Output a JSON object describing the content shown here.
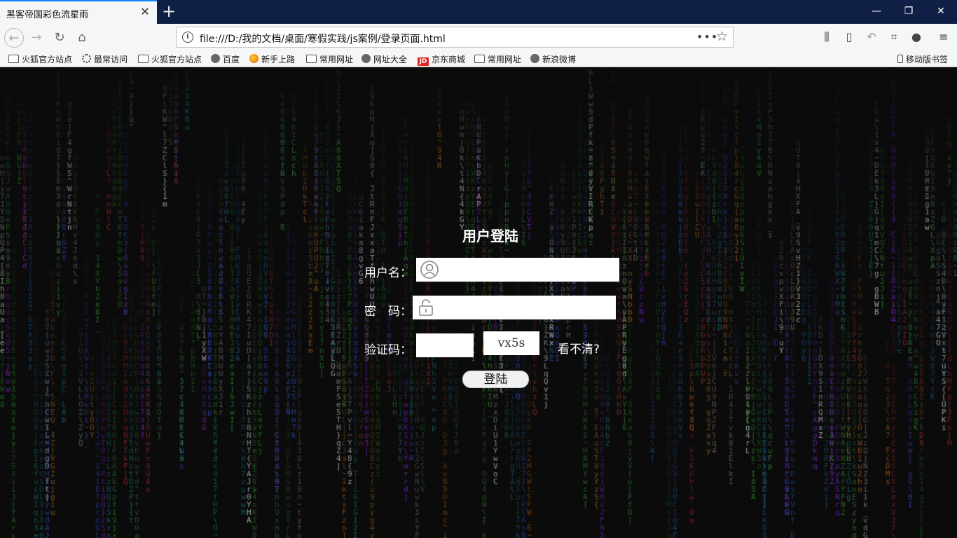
{
  "browser": {
    "tab_title": "黑客帝国彩色流星雨",
    "tab_close": "✕",
    "new_tab": "+",
    "window_controls": {
      "minimize": "—",
      "restore": "❐",
      "close": "✕"
    },
    "url": "file:///D:/我的文档/桌面/寒假实践/js案例/登录页面.html",
    "url_more": "•••",
    "bookmarks": [
      {
        "label": "火狐官方站点",
        "icon": "folder"
      },
      {
        "label": "最常访问",
        "icon": "gear"
      },
      {
        "label": "火狐官方站点",
        "icon": "folder"
      },
      {
        "label": "百度",
        "icon": "globe"
      },
      {
        "label": "新手上路",
        "icon": "fox"
      },
      {
        "label": "常用网址",
        "icon": "folder"
      },
      {
        "label": "网址大全",
        "icon": "globe"
      },
      {
        "label": "京东商城",
        "icon": "jd"
      },
      {
        "label": "常用网址",
        "icon": "folder"
      },
      {
        "label": "新浪微博",
        "icon": "globe"
      }
    ],
    "mobile_bookmarks": "移动版书签",
    "jd_icon_text": "JD"
  },
  "login": {
    "title": "用户登陆",
    "username_label": "用户名：",
    "password_label": "密　码：",
    "captcha_label": "验证码：",
    "captcha_value": "vx5s",
    "cant_see": "看不清?",
    "login_button": "登陆"
  },
  "colors": {
    "page_bg": "#0b0b0b",
    "tabbar_bg": "#0f1f46",
    "accent": "#0a84ff"
  }
}
